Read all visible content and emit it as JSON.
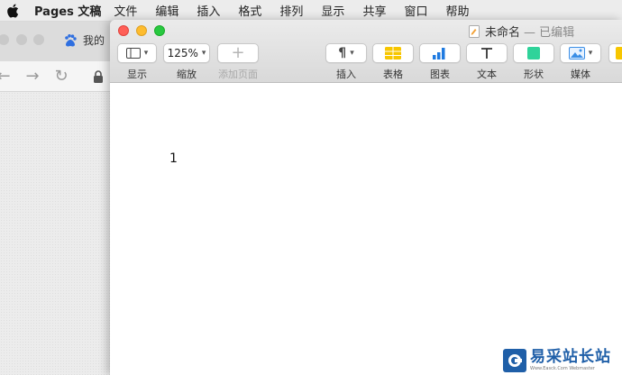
{
  "menubar": {
    "app_name": "Pages 文稿",
    "items": [
      "文件",
      "编辑",
      "插入",
      "格式",
      "排列",
      "显示",
      "共享",
      "窗口",
      "帮助"
    ]
  },
  "browser": {
    "tab_title": "我的"
  },
  "pages_window": {
    "title": "未命名",
    "status": "— 已编辑",
    "toolbar": {
      "view_label": "显示",
      "zoom_value": "125%",
      "zoom_label": "缩放",
      "add_page_label": "添加页面",
      "insert_label": "插入",
      "table_label": "表格",
      "chart_label": "图表",
      "text_label": "文本",
      "shape_label": "形状",
      "media_label": "媒体"
    },
    "document_text": "1"
  },
  "watermark": {
    "text": "易采站长站",
    "subtext": "Www.Easck.Com  Webmaster"
  },
  "colors": {
    "close": "#ff5f57",
    "minimize": "#febc2e",
    "zoom": "#28c840",
    "table_icon": "#f7c600",
    "chart_icon": "#1e7ae0",
    "shape_icon": "#2fd39a",
    "media_icon": "#3a8ee6"
  }
}
